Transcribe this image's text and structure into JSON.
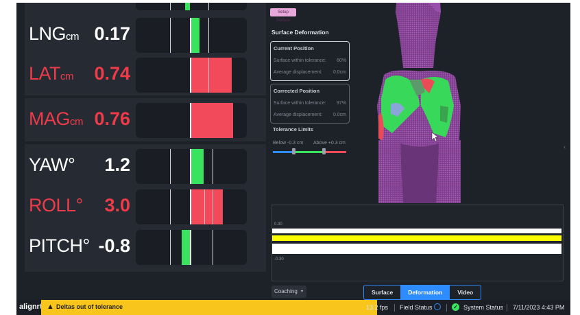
{
  "metrics": [
    {
      "label": "LNG",
      "unit": "cm",
      "value": "0.17",
      "status": "ok"
    },
    {
      "label": "LAT",
      "unit": "cm",
      "value": "0.74",
      "status": "out"
    },
    {
      "label": "MAG",
      "unit": "cm",
      "value": "0.76",
      "status": "out"
    },
    {
      "label": "YAW",
      "unit": "°",
      "value": "1.2",
      "status": "ok"
    },
    {
      "label": "ROLL",
      "unit": "°",
      "value": "3.0",
      "status": "out"
    },
    {
      "label": "PITCH",
      "unit": "°",
      "value": "-0.8",
      "status": "ok"
    }
  ],
  "surface_panel": {
    "setup_button": "Setup Surface",
    "title": "Surface Deformation",
    "current": {
      "title": "Current Position",
      "rows": [
        {
          "k": "Surface within tolerance:",
          "v": "60%"
        },
        {
          "k": "Average displacement:",
          "v": "0.0cm"
        }
      ]
    },
    "corrected": {
      "title": "Corrected Position",
      "rows": [
        {
          "k": "Surface within tolerance:",
          "v": "97%"
        },
        {
          "k": "Average displacement:",
          "v": "0.0cm"
        }
      ]
    },
    "tolerance": {
      "title": "Tolerance Limits",
      "below": "Below -0.3 cm",
      "above": "Above +0.3 cm"
    }
  },
  "graph": {
    "top_label": "0.30",
    "bottom_label": "-0.30"
  },
  "controls": {
    "coaching": "Coaching",
    "tabs": [
      "Surface",
      "Deformation",
      "Video"
    ],
    "active_tab": "Deformation"
  },
  "status_bar": {
    "logo": "alignrt",
    "warning": "Deltas out of tolerance",
    "fps": "13.2 fps",
    "field_status": "Field Status",
    "system_status": "System Status",
    "datetime": "7/11/2023 4:43 PM"
  },
  "colors": {
    "in_tolerance": "#39e35d",
    "out_of_tolerance": "#f24a5a",
    "warning": "#f8c51c",
    "accent": "#2d8cff"
  }
}
